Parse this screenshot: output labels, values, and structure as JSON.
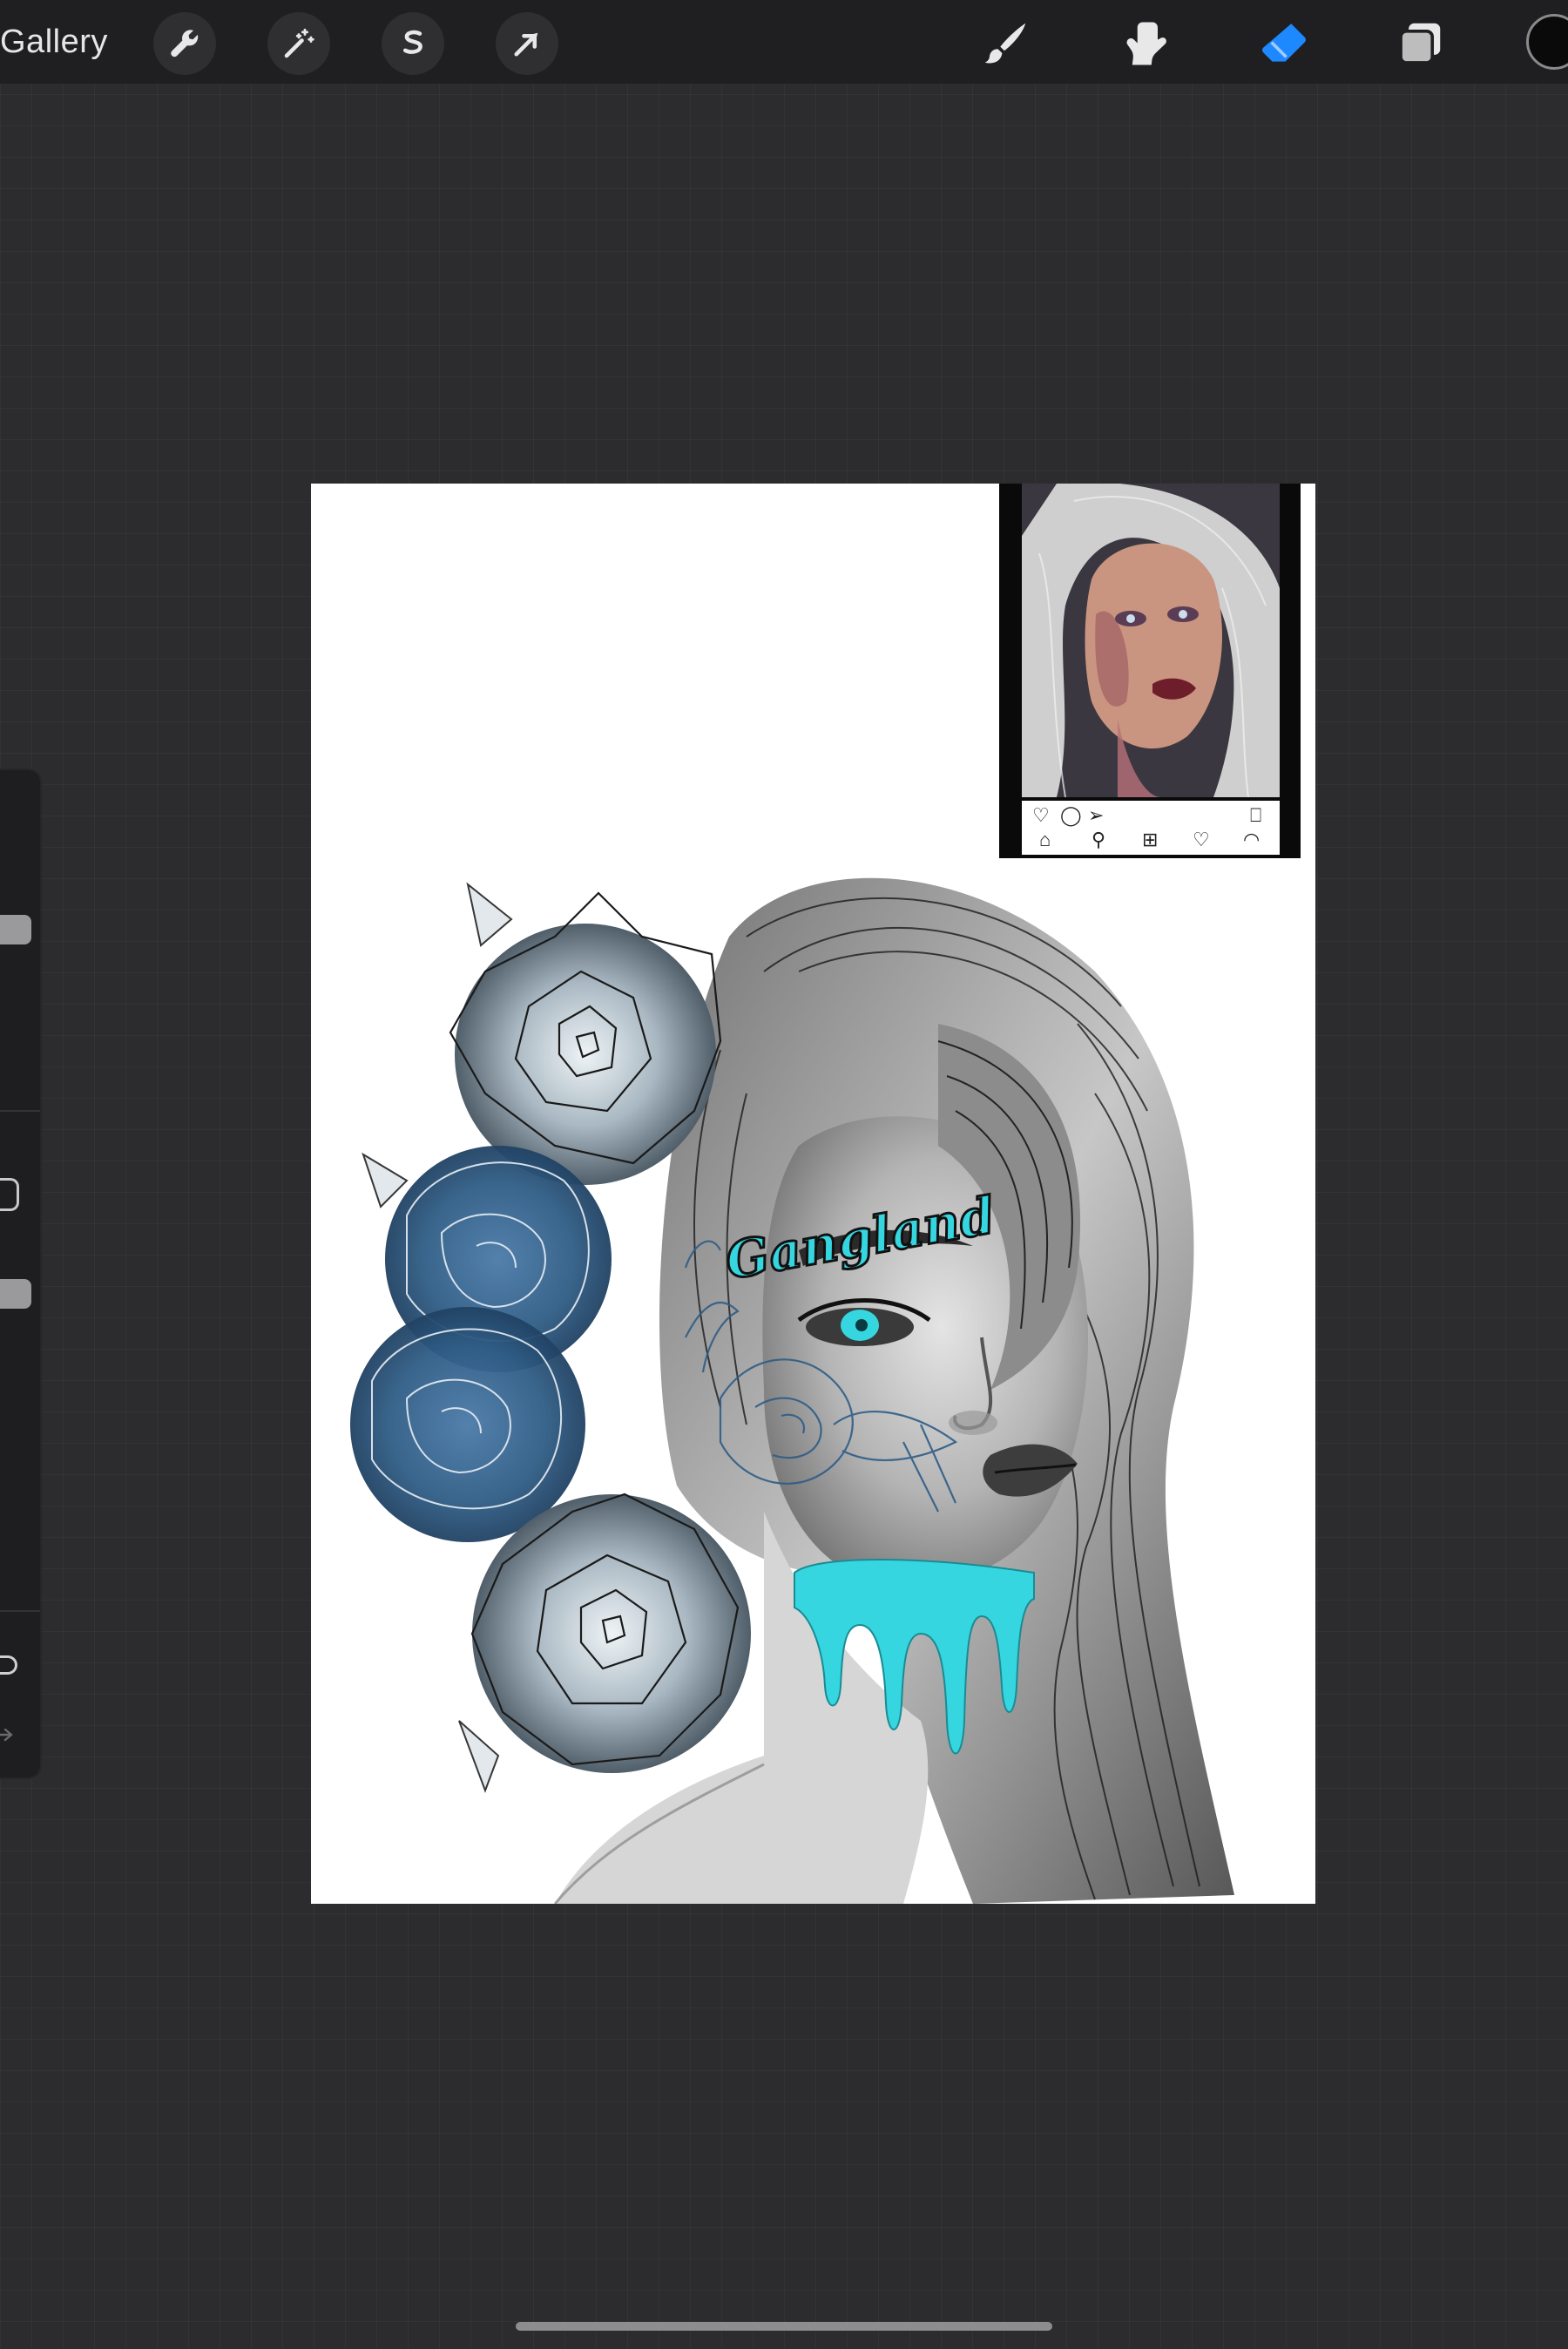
{
  "toolbar": {
    "gallery_label": "Gallery",
    "left_tools": [
      {
        "name": "actions",
        "icon": "wrench-icon"
      },
      {
        "name": "adjustments",
        "icon": "magic-wand-icon"
      },
      {
        "name": "selection",
        "icon": "selection-s-icon"
      },
      {
        "name": "transform",
        "icon": "arrow-cursor-icon"
      }
    ],
    "right_tools": [
      {
        "name": "brush",
        "icon": "brush-icon"
      },
      {
        "name": "smudge",
        "icon": "smudge-finger-icon"
      },
      {
        "name": "eraser",
        "icon": "eraser-icon",
        "active": true
      },
      {
        "name": "layers",
        "icon": "layers-icon"
      }
    ],
    "current_color": "#0a0a0a",
    "active_tool_color": "#1e88ff"
  },
  "sidebar": {
    "controls": [
      "brush-size-slider",
      "modify-button",
      "opacity-slider",
      "undo-button",
      "redo-button"
    ]
  },
  "canvas": {
    "artwork_text": "Gangland",
    "accent_color": "#35d6e0",
    "rose_color": "#2f5d86"
  },
  "reference_window": {
    "icons": [
      "heart-icon",
      "comment-icon",
      "send-icon",
      "bookmark-icon",
      "home-icon",
      "search-icon",
      "add-icon",
      "activity-icon",
      "profile-icon"
    ]
  }
}
